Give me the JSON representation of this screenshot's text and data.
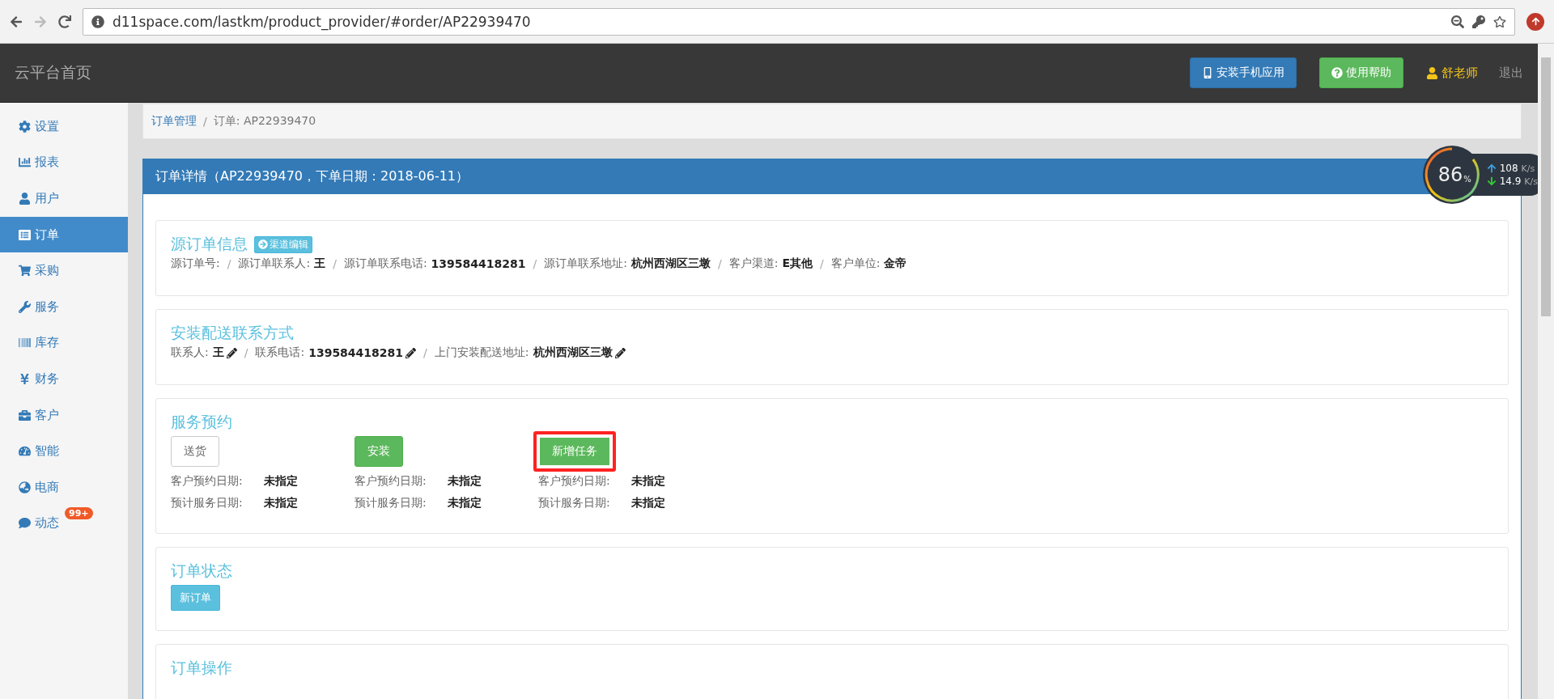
{
  "browser": {
    "url": "d11space.com/lastkm/product_provider/#order/AP22939470"
  },
  "navbar": {
    "brand": "云平台首页",
    "buttons": [
      {
        "label": "安装手机应用",
        "kind": "primary"
      },
      {
        "label": "使用帮助",
        "kind": "success"
      }
    ],
    "user": "舒老师",
    "logout": "退出"
  },
  "sidebar": {
    "items": [
      {
        "label": "设置",
        "selected": false
      },
      {
        "label": "报表",
        "selected": false
      },
      {
        "label": "用户",
        "selected": false
      },
      {
        "label": "订单",
        "selected": true
      },
      {
        "label": "采购",
        "selected": false
      },
      {
        "label": "服务",
        "selected": false
      },
      {
        "label": "库存",
        "selected": false
      },
      {
        "label": "财务",
        "selected": false
      },
      {
        "label": "客户",
        "selected": false
      },
      {
        "label": "智能",
        "selected": false
      },
      {
        "label": "电商",
        "selected": false
      },
      {
        "label": "动态",
        "selected": false,
        "badge": "99+"
      }
    ]
  },
  "breadcrumb": [
    {
      "label": "订单管理",
      "kind": "link"
    },
    {
      "sep": "/",
      "label": "订单: AP22939470",
      "kind": "current"
    }
  ],
  "panel": {
    "title": "订单详情（AP22939470，下单日期：2018-06-11）",
    "source_info": {
      "title": "源订单信息",
      "edit_button": "渠道编辑",
      "fields": [
        {
          "label": "源订单号:"
        },
        {
          "sep": "/",
          "label": "源订单联系人:",
          "value": "王"
        },
        {
          "sep": "/",
          "label": "源订单联系电话:",
          "value": "139584418281"
        },
        {
          "sep": "/",
          "label": "源订单联系地址:",
          "value": "杭州西湖区三墩"
        },
        {
          "sep": "/",
          "label": "客户渠道:",
          "value": "E其他"
        },
        {
          "sep": "/",
          "label": "客户单位:",
          "value": "金帝"
        }
      ]
    },
    "delivery": {
      "title": "安装配送联系方式",
      "fields": [
        {
          "label": "联系人:",
          "value": "王",
          "editable": true
        },
        {
          "sep": "/",
          "label": "联系电话:",
          "value": "139584418281",
          "editable": true
        },
        {
          "sep": "/",
          "label": "上门安装配送地址:",
          "value": "杭州西湖区三墩",
          "editable": true
        }
      ]
    },
    "service": {
      "title": "服务预约",
      "columns": [
        {
          "button": {
            "label": "送货",
            "kind": "default"
          },
          "highlighted": false,
          "rows": [
            {
              "label": "客户预约日期:",
              "value": "未指定"
            },
            {
              "label": "预计服务日期:",
              "value": "未指定"
            }
          ]
        },
        {
          "button": {
            "label": "安装",
            "kind": "success"
          },
          "highlighted": false,
          "rows": [
            {
              "label": "客户预约日期:",
              "value": "未指定"
            },
            {
              "label": "预计服务日期:",
              "value": "未指定"
            }
          ]
        },
        {
          "button": {
            "label": "新增任务",
            "kind": "success"
          },
          "highlighted": true,
          "rows": [
            {
              "label": "客户预约日期:",
              "value": "未指定"
            },
            {
              "label": "预计服务日期:",
              "value": "未指定"
            }
          ]
        }
      ]
    },
    "status": {
      "title": "订单状态",
      "tag": "新订单"
    },
    "operations": {
      "title": "订单操作"
    }
  },
  "speed_widget": {
    "percent": "86",
    "unit": "%",
    "up": "108",
    "down": "14.9",
    "up_unit": "K/s",
    "down_unit": "K/s"
  }
}
